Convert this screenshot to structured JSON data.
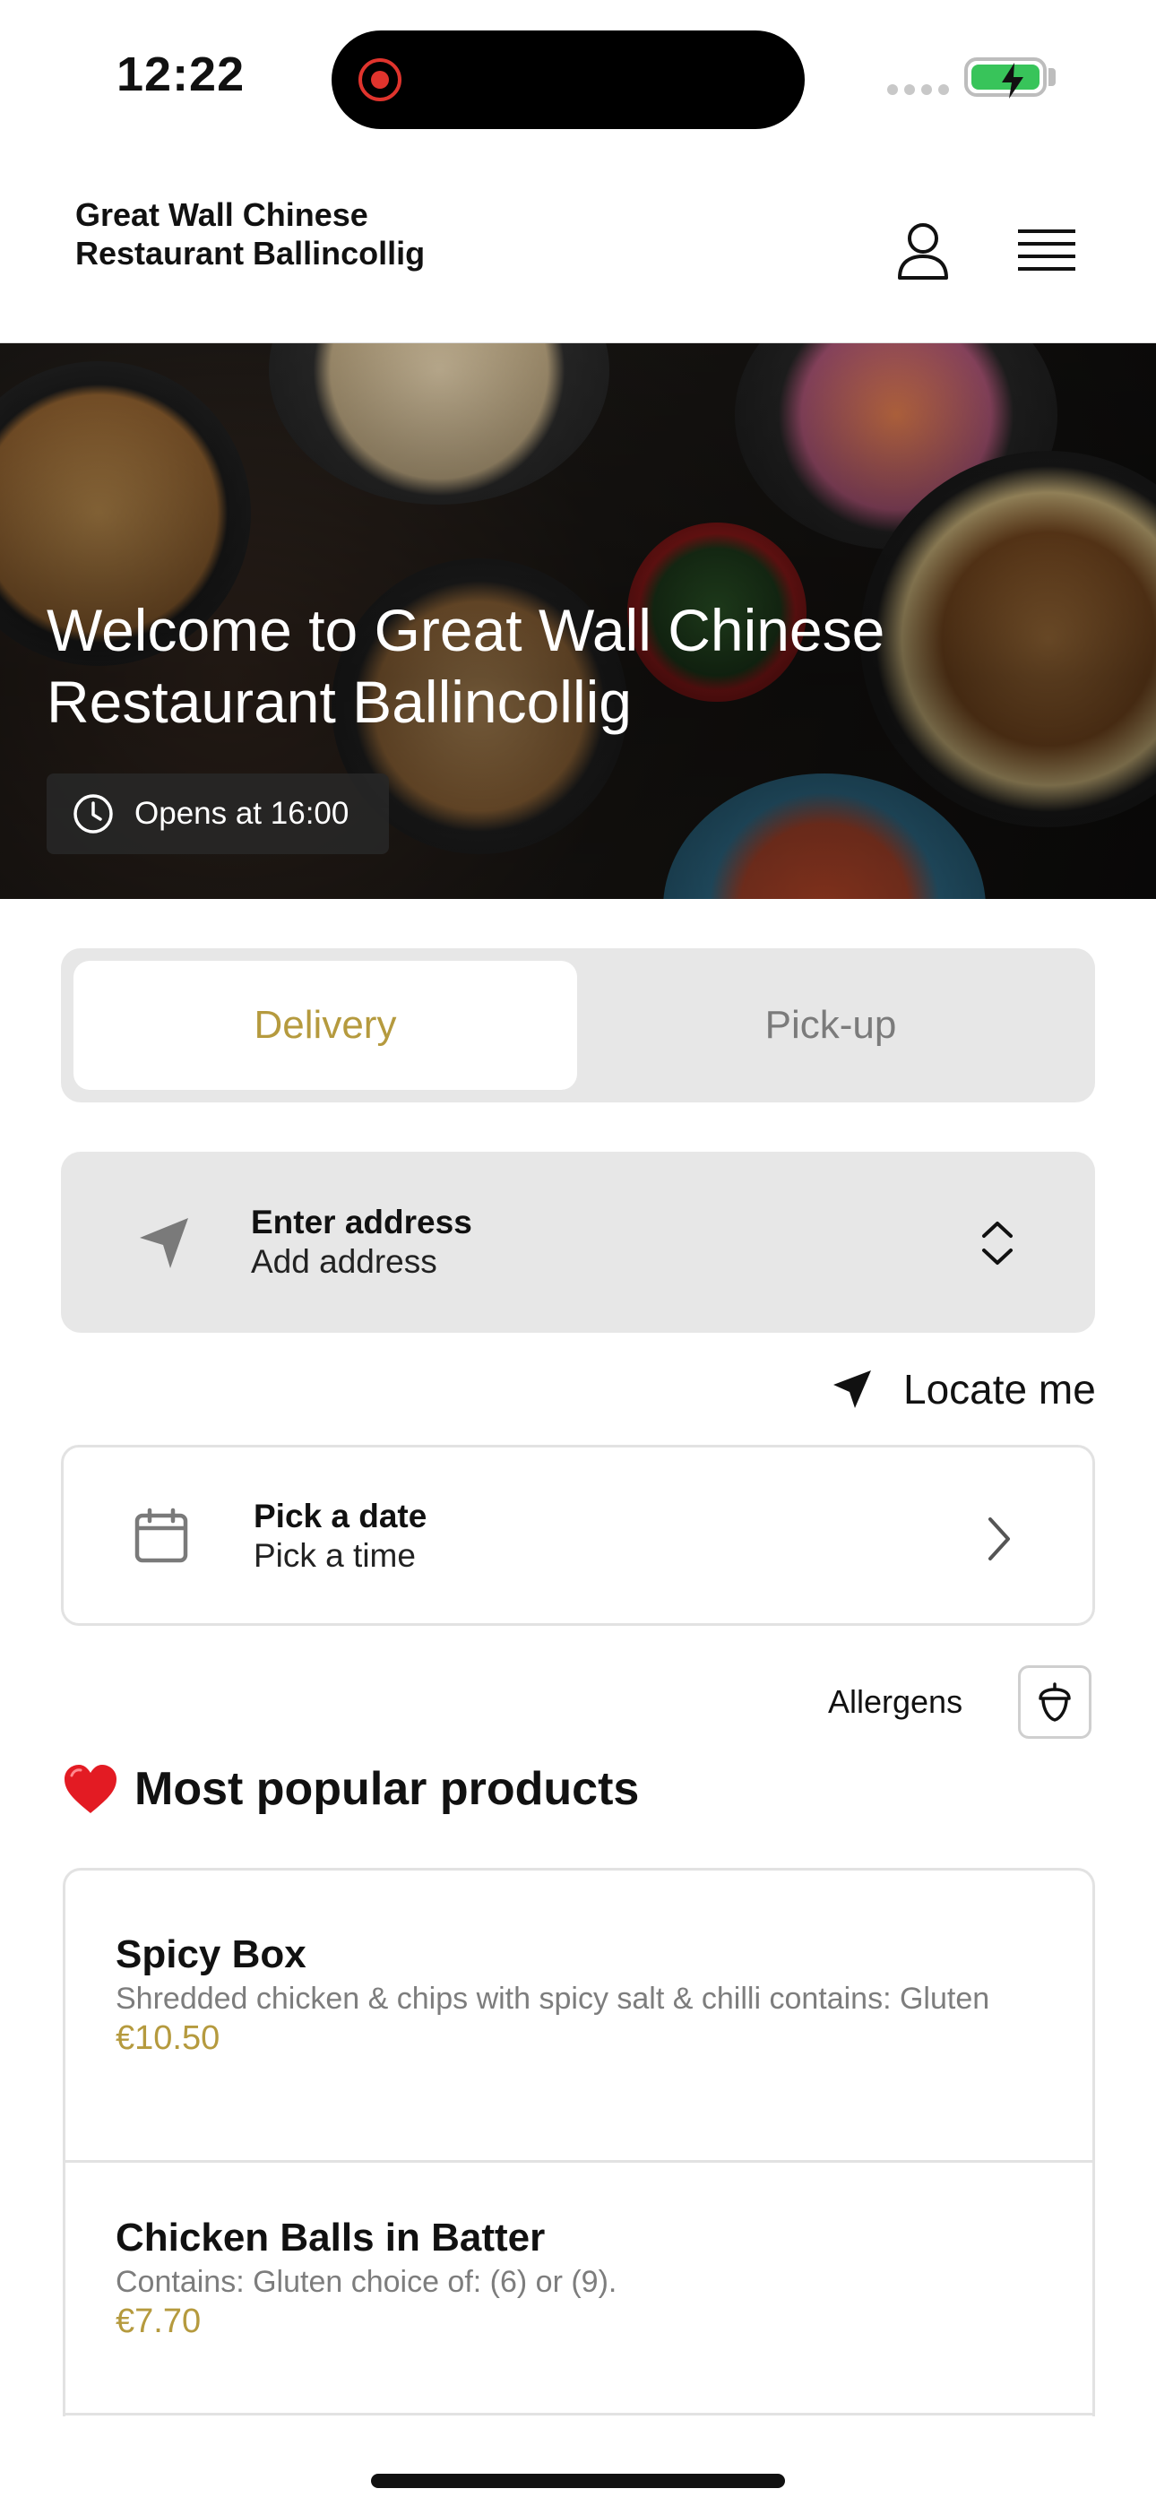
{
  "status_bar": {
    "time": "12:22"
  },
  "header": {
    "title": "Great Wall Chinese Restaurant Ballincollig"
  },
  "hero": {
    "title": "Welcome to Great Wall Chinese Restaurant Ballincollig",
    "hours": "Opens at 16:00"
  },
  "mode": {
    "options": [
      "Delivery",
      "Pick-up"
    ],
    "selected": "Delivery",
    "accent_color": "#b59a3e"
  },
  "address": {
    "title": "Enter address",
    "subtitle": "Add address"
  },
  "locate": {
    "label": "Locate me"
  },
  "schedule": {
    "date_label": "Pick a date",
    "time_label": "Pick a time"
  },
  "allergens": {
    "label": "Allergens"
  },
  "popular": {
    "title": "Most popular products",
    "products": [
      {
        "name": "Spicy Box",
        "description": "Shredded chicken & chips with spicy salt & chilli contains: Gluten",
        "price": "€10.50"
      },
      {
        "name": "Chicken Balls in Batter",
        "description": "Contains: Gluten choice of: (6) or (9).",
        "price": "€7.70"
      }
    ]
  },
  "icons": {
    "user": "user-icon",
    "menu": "hamburger-menu-icon",
    "clock": "clock-icon",
    "navigation": "navigation-arrow-icon",
    "chevrons": "chevron-up-down-icon",
    "calendar": "calendar-icon",
    "chevron_right": "chevron-right-icon",
    "acorn": "acorn-icon",
    "heart": "heart-icon"
  }
}
